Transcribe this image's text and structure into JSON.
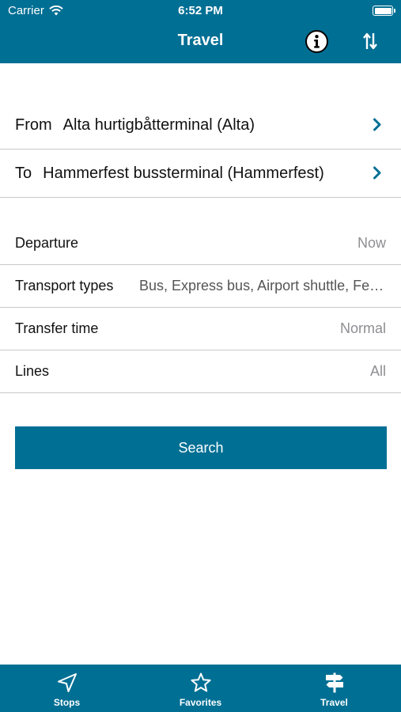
{
  "status_bar": {
    "carrier": "Carrier",
    "time": "6:52 PM"
  },
  "nav": {
    "title": "Travel",
    "info_icon": "info-icon",
    "swap_icon": "swap-vertical-icon"
  },
  "route": {
    "from_label": "From",
    "from_value": "Alta hurtigbåtterminal (Alta)",
    "to_label": "To",
    "to_value": "Hammerfest bussterminal (Hammerfest)"
  },
  "options": [
    {
      "label": "Departure",
      "value": "Now"
    },
    {
      "label": "Transport types",
      "value": "Bus, Express bus, Airport shuttle, Ferry"
    },
    {
      "label": "Transfer time",
      "value": "Normal"
    },
    {
      "label": "Lines",
      "value": "All"
    }
  ],
  "search_label": "Search",
  "tabs": [
    {
      "label": "Stops",
      "icon": "location-arrow-icon"
    },
    {
      "label": "Favorites",
      "icon": "star-icon"
    },
    {
      "label": "Travel",
      "icon": "signpost-icon"
    }
  ],
  "colors": {
    "brand": "#006f94",
    "chevron": "#006f94",
    "separator": "#c8c8c8",
    "muted_value": "#8e8e93"
  }
}
